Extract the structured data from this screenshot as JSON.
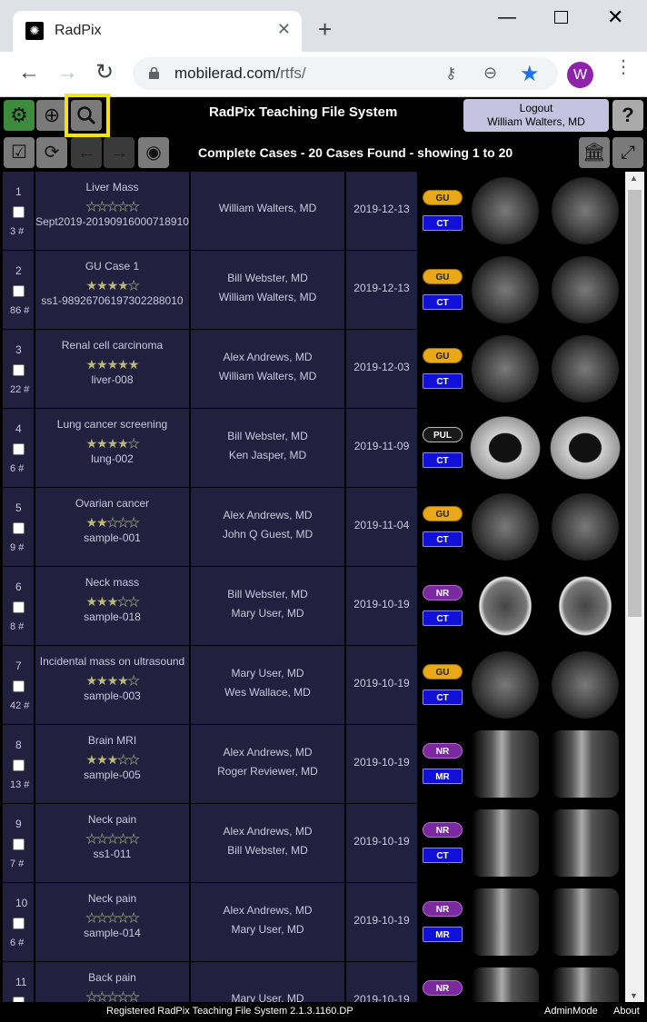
{
  "browser": {
    "tab_title": "RadPix",
    "tab_close": "✕",
    "new_tab": "+",
    "url_host": "mobilerad.com/",
    "url_path": "rtfs/",
    "avatar_letter": "W",
    "icons": [
      "back-arrow-icon",
      "forward-arrow-icon",
      "reload-icon",
      "lock-icon",
      "key-icon",
      "zoom-out-icon",
      "star-icon",
      "kebab-icon"
    ]
  },
  "header": {
    "title": "RadPix Teaching File System",
    "logout_label": "Logout",
    "user_name": "William Walters, MD",
    "help_label": "?",
    "summary": "Complete Cases - 20 Cases Found - showing 1 to 20"
  },
  "colors": {
    "gu": "#e8a81a",
    "nr": "#7a2a9e",
    "modality": "#1010d8",
    "row_bg": "#21213f",
    "highlight": "#f5e600"
  },
  "cases": [
    {
      "num": "1",
      "count": "3 #",
      "title": "Liver Mass",
      "stars": 0,
      "id": "Sept2019-20190916000718910",
      "authors": [
        "William Walters, MD"
      ],
      "date": "2019-12-13",
      "specialty": "GU",
      "modality": "CT",
      "scan": "abd"
    },
    {
      "num": "2",
      "count": "86 #",
      "title": "GU Case 1",
      "stars": 4,
      "id": "ss1-98926706197302288010",
      "authors": [
        "Bill Webster, MD",
        "William Walters, MD"
      ],
      "date": "2019-12-13",
      "specialty": "GU",
      "modality": "CT",
      "scan": "abd"
    },
    {
      "num": "3",
      "count": "22 #",
      "title": "Renal cell carcinoma",
      "stars": 5,
      "id": "liver-008",
      "authors": [
        "Alex Andrews, MD",
        "William Walters, MD"
      ],
      "date": "2019-12-03",
      "specialty": "GU",
      "modality": "CT",
      "scan": "abd"
    },
    {
      "num": "4",
      "count": "6 #",
      "title": "Lung cancer screening",
      "stars": 4,
      "id": "lung-002",
      "authors": [
        "Bill Webster, MD",
        "Ken Jasper, MD"
      ],
      "date": "2019-11-09",
      "specialty": "PUL",
      "modality": "CT",
      "scan": "lung"
    },
    {
      "num": "5",
      "count": "9 #",
      "title": "Ovarian cancer",
      "stars": 2,
      "id": "sample-001",
      "authors": [
        "Alex Andrews, MD",
        "John Q Guest, MD"
      ],
      "date": "2019-11-04",
      "specialty": "GU",
      "modality": "CT",
      "scan": "abd"
    },
    {
      "num": "6",
      "count": "8 #",
      "title": "Neck mass",
      "stars": 3,
      "id": "sample-018",
      "authors": [
        "Bill Webster, MD",
        "Mary User, MD"
      ],
      "date": "2019-10-19",
      "specialty": "NR",
      "modality": "CT",
      "scan": "brain"
    },
    {
      "num": "7",
      "count": "42 #",
      "title": "Incidental mass on ultrasound",
      "stars": 4,
      "id": "sample-003",
      "authors": [
        "Mary User, MD",
        "Wes Wallace, MD"
      ],
      "date": "2019-10-19",
      "specialty": "GU",
      "modality": "CT",
      "scan": "abd"
    },
    {
      "num": "8",
      "count": "13 #",
      "title": "Brain MRI",
      "stars": 3,
      "id": "sample-005",
      "authors": [
        "Alex Andrews, MD",
        "Roger Reviewer, MD"
      ],
      "date": "2019-10-19",
      "specialty": "NR",
      "modality": "MR",
      "scan": "sag"
    },
    {
      "num": "9",
      "count": "7 #",
      "title": "Neck pain",
      "stars": 0,
      "id": "ss1-011",
      "authors": [
        "Alex Andrews, MD",
        "Bill Webster, MD"
      ],
      "date": "2019-10-19",
      "specialty": "NR",
      "modality": "CT",
      "scan": "sag"
    },
    {
      "num": "10",
      "count": "6 #",
      "title": "Neck pain",
      "stars": 0,
      "id": "sample-014",
      "authors": [
        "Alex Andrews, MD",
        "Mary User, MD"
      ],
      "date": "2019-10-19",
      "specialty": "NR",
      "modality": "MR",
      "scan": "sag"
    },
    {
      "num": "11",
      "count": "",
      "title": "Back pain",
      "stars": 0,
      "id": "",
      "authors": [
        "Mary User, MD"
      ],
      "date": "2019-10-19",
      "specialty": "NR",
      "modality": "",
      "scan": "sag"
    }
  ],
  "footer": {
    "text": "Registered RadPix Teaching File System 2.1.3.1160.DP",
    "admin": "AdminMode",
    "about": "About"
  }
}
